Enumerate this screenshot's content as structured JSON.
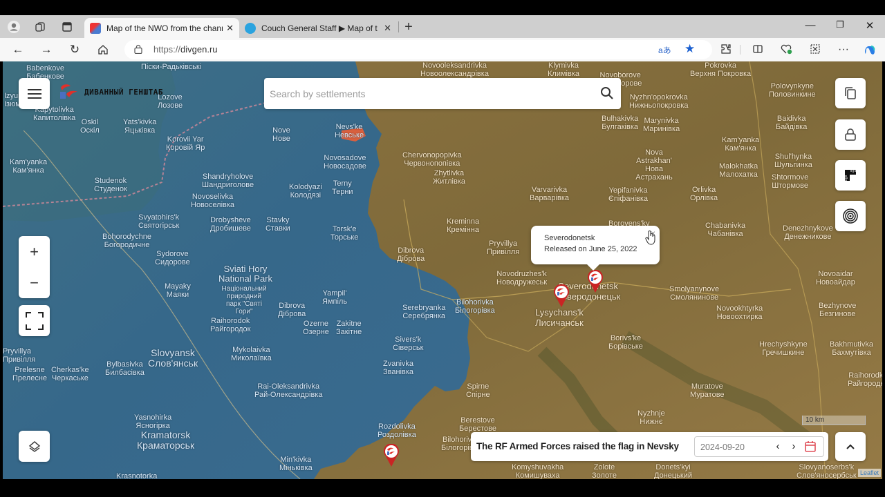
{
  "browser": {
    "tabs": [
      {
        "label": "Map of the NWO from the channel",
        "active": true
      },
      {
        "label": "Couch General Staff ▶ Map of the",
        "active": false
      }
    ],
    "url_scheme": "https://",
    "url_host": "divgen.ru",
    "new_tab_label": "+",
    "window_controls": {
      "minimize": "—",
      "maximize": "❐",
      "close": "✕"
    }
  },
  "map": {
    "logo_text": "ДИВАННЫЙ ГЕНШТАБ",
    "search_placeholder": "Search by settlements",
    "zoom_in": "+",
    "zoom_out": "−",
    "popup": {
      "title": "Severodonetsk",
      "body": "Released on June 25, 2022",
      "close": "×"
    },
    "event": {
      "text": "The RF Armed Forces raised the flag in Nevsky",
      "date": "2024-09-20",
      "prev": "‹",
      "next": "›"
    },
    "scale_label": "10 km",
    "attribution": "Leaflet",
    "colors": {
      "ukraine_controlled": "#3c6e94",
      "russia_controlled": "#8f7440",
      "recent_change": "#d8603f",
      "marker": "#cc2222"
    },
    "places": [
      {
        "en": "Babenkove",
        "uk": "Бабенкове",
        "side": "blue"
      },
      {
        "en": "",
        "uk": "Піски-Радьківські",
        "side": "blue"
      },
      {
        "en": "Izyum",
        "uk": "Ізюм",
        "side": "blue"
      },
      {
        "en": "Lozove",
        "uk": "Лозове",
        "side": "blue"
      },
      {
        "en": "Kapytolivka",
        "uk": "Капитолівка",
        "side": "blue"
      },
      {
        "en": "Oskil",
        "uk": "Оскіл",
        "side": "blue"
      },
      {
        "en": "Yats'kivka",
        "uk": "Яцьківка",
        "side": "blue"
      },
      {
        "en": "Korovii Yar",
        "uk": "Коровій Яр",
        "side": "blue"
      },
      {
        "en": "Kam'yanka",
        "uk": "Кам'янка",
        "side": "blue"
      },
      {
        "en": "Studenok",
        "uk": "Студенок",
        "side": "blue"
      },
      {
        "en": "Shandryholove",
        "uk": "Шандриголове",
        "side": "blue"
      },
      {
        "en": "Novoselivka",
        "uk": "Новоселівка",
        "side": "blue"
      },
      {
        "en": "Nove",
        "uk": "Нове",
        "side": "blue"
      },
      {
        "en": "Nevs'ke",
        "uk": "Невське",
        "side": "blue"
      },
      {
        "en": "Novosadove",
        "uk": "Новосадове",
        "side": "blue"
      },
      {
        "en": "Terny",
        "uk": "Терни",
        "side": "blue"
      },
      {
        "en": "Kolodyazi",
        "uk": "Колодязі",
        "side": "blue"
      },
      {
        "en": "Svyatohirs'k",
        "uk": "Святогірськ",
        "side": "blue"
      },
      {
        "en": "Drobysheve",
        "uk": "Дробишеве",
        "side": "blue"
      },
      {
        "en": "Stavky",
        "uk": "Ставки",
        "side": "blue"
      },
      {
        "en": "Bohorodychne",
        "uk": "Богородичне",
        "side": "blue"
      },
      {
        "en": "Sydorove",
        "uk": "Сидорове",
        "side": "blue"
      },
      {
        "en": "Torsk'e",
        "uk": "Торське",
        "side": "blue"
      },
      {
        "en": "Mayaky",
        "uk": "Маяки",
        "side": "blue"
      },
      {
        "en": "Sviati Hory National Park",
        "uk": "Національний природний парк \"Святі Гори\"",
        "side": "blue"
      },
      {
        "en": "Yampil'",
        "uk": "Ямпіль",
        "side": "blue"
      },
      {
        "en": "Dibrova",
        "uk": "Діброва",
        "side": "blue"
      },
      {
        "en": "Raihorodok",
        "uk": "Райгородок",
        "side": "blue"
      },
      {
        "en": "Ozerne",
        "uk": "Озерне",
        "side": "blue"
      },
      {
        "en": "Zakitne",
        "uk": "Закітне",
        "side": "blue"
      },
      {
        "en": "Serebryanka",
        "uk": "Серебрянка",
        "side": "blue"
      },
      {
        "en": "Bilohorivka",
        "uk": "Білогорівка",
        "side": "blue"
      },
      {
        "en": "Sivers'k",
        "uk": "Сіверськ",
        "side": "blue"
      },
      {
        "en": "Slovyansk",
        "uk": "Слов'янськ",
        "side": "blue"
      },
      {
        "en": "Mykolaivka",
        "uk": "Миколаївка",
        "side": "blue"
      },
      {
        "en": "Pryvillya",
        "uk": "Привілля",
        "side": "blue"
      },
      {
        "en": "Bylbasivka",
        "uk": "Билбасівка",
        "side": "blue"
      },
      {
        "en": "Cherkas'ke",
        "uk": "Черкаське",
        "side": "blue"
      },
      {
        "en": "Prelesne",
        "uk": "Прелесне",
        "side": "blue"
      },
      {
        "en": "Rai-Oleksandrivka",
        "uk": "Рай-Олександрівка",
        "side": "blue"
      },
      {
        "en": "Zvanivka",
        "uk": "Званівка",
        "side": "blue"
      },
      {
        "en": "Yasnohirka",
        "uk": "Ясногірка",
        "side": "blue"
      },
      {
        "en": "Kramatorsk",
        "uk": "Краматорськ",
        "side": "blue"
      },
      {
        "en": "Min'kivka",
        "uk": "Міньківка",
        "side": "blue"
      },
      {
        "en": "Krasnotorka",
        "uk": "",
        "side": "blue"
      },
      {
        "en": "Rozdolivka",
        "uk": "Роздолівка",
        "side": "blue"
      },
      {
        "en": "Novooleksandrivka",
        "uk": "Новоолександрівка",
        "side": "brown"
      },
      {
        "en": "Klymivka",
        "uk": "Климівка",
        "side": "brown"
      },
      {
        "en": "Novoborove",
        "uk": "Новоборове",
        "side": "brown"
      },
      {
        "en": "Pokrovka",
        "uk": "Верхня Покровка",
        "side": "brown"
      },
      {
        "en": "Nyzhn'opokrovka",
        "uk": "Нижньопокровка",
        "side": "brown"
      },
      {
        "en": "Polovynkyne",
        "uk": "Половинкине",
        "side": "brown"
      },
      {
        "en": "Bulhakivka",
        "uk": "Булгаківка",
        "side": "brown"
      },
      {
        "en": "Marynivka",
        "uk": "Маринівка",
        "side": "brown"
      },
      {
        "en": "Baidivka",
        "uk": "Байдівка",
        "side": "brown"
      },
      {
        "en": "Chervonopopivka",
        "uk": "Червонопопівка",
        "side": "brown"
      },
      {
        "en": "Zhytlivka",
        "uk": "Житлівка",
        "side": "brown"
      },
      {
        "en": "Kam'yanka",
        "uk": "Кам'янка",
        "side": "brown"
      },
      {
        "en": "Nova Astrakhan'",
        "uk": "Нова Астрахань",
        "side": "brown"
      },
      {
        "en": "Shul'hynka",
        "uk": "Шульгинка",
        "side": "brown"
      },
      {
        "en": "Malokhatka",
        "uk": "Малохатка",
        "side": "brown"
      },
      {
        "en": "Shtormove",
        "uk": "Штормове",
        "side": "brown"
      },
      {
        "en": "Varvarivka",
        "uk": "Варварівка",
        "side": "brown"
      },
      {
        "en": "Yepifanivka",
        "uk": "Єпіфанівка",
        "side": "brown"
      },
      {
        "en": "Orlivka",
        "uk": "Орлівка",
        "side": "brown"
      },
      {
        "en": "Kreminna",
        "uk": "Кремінна",
        "side": "brown"
      },
      {
        "en": "Borovens'ky",
        "uk": "",
        "side": "brown"
      },
      {
        "en": "Chabanivka",
        "uk": "Чабанівка",
        "side": "brown"
      },
      {
        "en": "Denezhnykove",
        "uk": "Денежникове",
        "side": "brown"
      },
      {
        "en": "Dibrova",
        "uk": "Діброва",
        "side": "brown"
      },
      {
        "en": "Pryvillya",
        "uk": "Привілля",
        "side": "brown"
      },
      {
        "en": "Novodruzhes'k",
        "uk": "Новодружеськ",
        "side": "brown"
      },
      {
        "en": "Severodonetsk",
        "uk": "Сєверодонецьк",
        "side": "brown"
      },
      {
        "en": "Lysychans'k",
        "uk": "Лисичанськ",
        "side": "brown"
      },
      {
        "en": "Smolyanynove",
        "uk": "Смолянинове",
        "side": "brown"
      },
      {
        "en": "Novoaidar",
        "uk": "Новоайдар",
        "side": "brown"
      },
      {
        "en": "Novookhtyrka",
        "uk": "Новоохтирка",
        "side": "brown"
      },
      {
        "en": "Bezhynove",
        "uk": "Безгинове",
        "side": "brown"
      },
      {
        "en": "Borivs'ke",
        "uk": "Борівське",
        "side": "brown"
      },
      {
        "en": "Hrechyshkyne",
        "uk": "Гречишкине",
        "side": "brown"
      },
      {
        "en": "Bakhmutivka",
        "uk": "Бахмутівка",
        "side": "brown"
      },
      {
        "en": "Raihorodka",
        "uk": "Райгородка",
        "side": "brown"
      },
      {
        "en": "Spirne",
        "uk": "Спірне",
        "side": "brown"
      },
      {
        "en": "Muratove",
        "uk": "Муратове",
        "side": "brown"
      },
      {
        "en": "Berestove",
        "uk": "Берестове",
        "side": "brown"
      },
      {
        "en": "Nyzhnje",
        "uk": "Нижнє",
        "side": "brown"
      },
      {
        "en": "Bilohorivka",
        "uk": "Білогорівка",
        "side": "brown"
      },
      {
        "en": "Komyshuvakha",
        "uk": "Комишуваха",
        "side": "brown"
      },
      {
        "en": "Zolote",
        "uk": "Золоте",
        "side": "brown"
      },
      {
        "en": "Donets'kyi",
        "uk": "Донецький",
        "side": "brown"
      },
      {
        "en": "Slovyanoserbs'k",
        "uk": "Слов'яносербськ",
        "side": "brown"
      }
    ]
  }
}
